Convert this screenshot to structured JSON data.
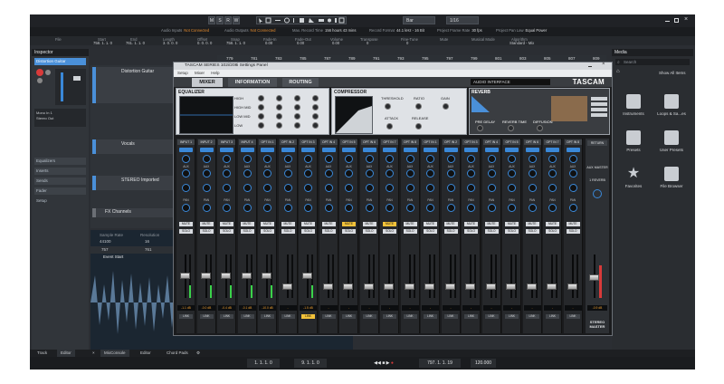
{
  "topbar": {
    "buttons": [
      "M",
      "S",
      "R",
      "W"
    ],
    "snap": "Bar",
    "quantize": "1/16"
  },
  "status": [
    {
      "key": "Audio Inputs",
      "value": "Not Connected",
      "warn": true
    },
    {
      "key": "Audio Outputs",
      "value": "Not Connected",
      "warn": true
    },
    {
      "key": "Max. Record Time",
      "value": "156 hours 43 mins",
      "warn": false
    },
    {
      "key": "Record Format",
      "value": "44.1 kHz - 16 Bit",
      "warn": false
    },
    {
      "key": "Project Frame Rate",
      "value": "30 fps",
      "warn": false
    },
    {
      "key": "Project Pan Law",
      "value": "Equal Power",
      "warn": false
    }
  ],
  "infoline": {
    "headers": [
      "File",
      "Start",
      "End",
      "Length",
      "Offset",
      "Snap",
      "Fade-In",
      "Fade-Out",
      "Volume",
      "Transpose",
      "Fine-Tune",
      "Mute",
      "Musical Mode",
      "Algorithm"
    ],
    "values": [
      "",
      "758. 1. 1. 0",
      "761. 1. 1. 0",
      "3. 0. 0. 0",
      "0. 0. 0. 0",
      "758. 1. 1. 0",
      "0.00",
      "0.00",
      "0.00",
      "0",
      "0",
      "",
      "",
      "Standard - Mix"
    ]
  },
  "inspector": {
    "title": "Inspector",
    "track_name": "Distortion Guitar",
    "routing_in": "Mono In 1",
    "routing_out": "Stereo Out",
    "sections": [
      "Equalizers",
      "Inserts",
      "Sends",
      "Fader",
      "Setup"
    ]
  },
  "tracks": [
    {
      "name": "Distortion Guitar"
    },
    {
      "name": "Vocals"
    },
    {
      "name": "STEREO Imported"
    },
    {
      "name": "FX Channels"
    }
  ],
  "ruler": [
    "779",
    "781",
    "783",
    "785",
    "787",
    "789",
    "791",
    "793",
    "795",
    "797",
    "799",
    "801",
    "803",
    "805",
    "807",
    "809"
  ],
  "editor": {
    "sample_rate_label": "Sample Rate",
    "sample_rate": "44100",
    "resolution_label": "Resolution",
    "resolution": "16",
    "ruler": [
      "757",
      "761",
      "765"
    ],
    "event_label": "Event Start"
  },
  "media": {
    "title": "Media",
    "search_placeholder": "Search",
    "show_all": "Show All Items",
    "tiles": [
      "Instruments",
      "Loops & Sa...es",
      "Presets",
      "User Presets",
      "Favorites",
      "File Browser"
    ]
  },
  "bottom_tabs": [
    "Track",
    "Editor",
    "MixConsole",
    "Editor",
    "Chord Pads"
  ],
  "transport": {
    "left_locator": "1. 1. 1. 0",
    "right_locator": "9. 1. 1. 0",
    "position": "797. 1. 1. 19",
    "tempo": "120.000"
  },
  "tascam": {
    "title": "TASCAM SERIES 102i/208i Settings Panel",
    "menu": [
      "Setup",
      "Mixer",
      "Help"
    ],
    "tabs": [
      "MIXER",
      "INFORMATION",
      "ROUTING"
    ],
    "interface": "AUDIO INTERFACE",
    "brand": "TASCAM",
    "eq": {
      "title": "EQUALIZER",
      "bands": [
        "HIGH",
        "HIGH MID",
        "LOW MID",
        "LOW"
      ]
    },
    "comp": {
      "title": "COMPRESSOR",
      "labels": [
        "THRESHOLD",
        "RATIO",
        "GAIN",
        "ATTACK",
        "RELEASE"
      ]
    },
    "reverb": {
      "title": "REVERB",
      "labels": [
        "PRE DELAY",
        "REVERB TIME",
        "DIFFUSION"
      ]
    },
    "strips": [
      {
        "input": "INPUT 1",
        "db": "-1.1 dB",
        "mute": false,
        "link": false
      },
      {
        "input": "INPUT 2",
        "db": "-0.0 dB",
        "mute": false,
        "link": false
      },
      {
        "input": "INPUT 3",
        "db": "-0.4 dB",
        "mute": false,
        "link": false
      },
      {
        "input": "INPUT 4",
        "db": "-0.1 dB",
        "mute": false,
        "link": false
      },
      {
        "input": "OPT IN 1",
        "db": "-10.0 dB",
        "mute": false,
        "link": false
      },
      {
        "input": "OPT IN 2",
        "db": "-",
        "mute": false,
        "link": false
      },
      {
        "input": "OPT IN 3",
        "db": "-1.5 dB",
        "mute": false,
        "link": true
      },
      {
        "input": "OPT IN 4",
        "db": "-",
        "mute": false,
        "link": false
      },
      {
        "input": "OPT IN 5",
        "db": "-",
        "mute": true,
        "link": false
      },
      {
        "input": "OPT IN 6",
        "db": "-",
        "mute": false,
        "link": false
      },
      {
        "input": "OPT IN 7",
        "db": "-",
        "mute": true,
        "link": false
      },
      {
        "input": "OPT IN 8",
        "db": "-",
        "mute": false,
        "link": false
      },
      {
        "input": "OPT IN 1",
        "db": "-",
        "mute": false,
        "link": false
      },
      {
        "input": "OPT IN 2",
        "db": "-",
        "mute": false,
        "link": false
      },
      {
        "input": "OPT IN 3",
        "db": "-",
        "mute": false,
        "link": false
      },
      {
        "input": "OPT IN 4",
        "db": "-",
        "mute": false,
        "link": false
      },
      {
        "input": "OPT IN 5",
        "db": "-",
        "mute": false,
        "link": false
      },
      {
        "input": "OPT IN 6",
        "db": "-",
        "mute": false,
        "link": false
      },
      {
        "input": "OPT IN 7",
        "db": "-",
        "mute": false,
        "link": false
      },
      {
        "input": "OPT IN 8",
        "db": "-",
        "mute": false,
        "link": false
      }
    ],
    "strip_labels": {
      "aux": "AUX",
      "pan": "PAN",
      "mute": "MUTE",
      "solo": "SOLO",
      "link": "LINK"
    },
    "master": {
      "label": "STEREO MASTER",
      "aux": "AUX MASTER",
      "return": "RETURN",
      "reverb": "1 REVERB",
      "db": "-0.9 dB"
    }
  }
}
